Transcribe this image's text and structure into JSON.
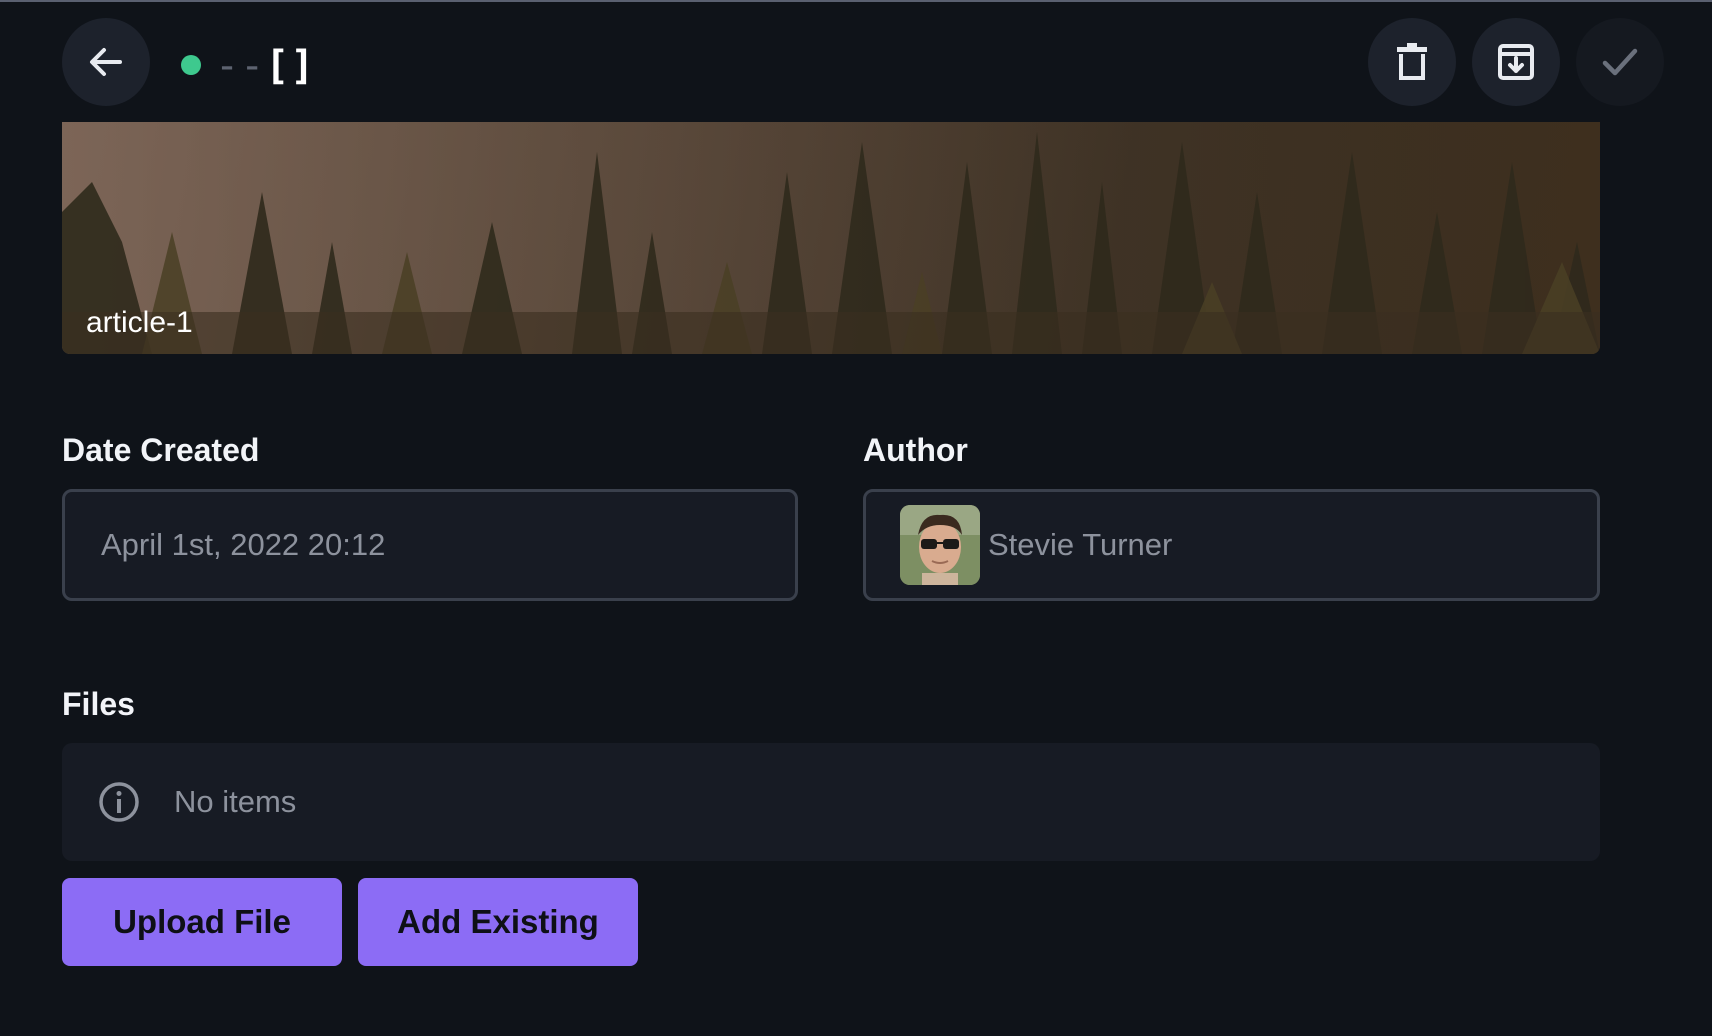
{
  "header": {
    "title_dim": "--",
    "title_main": "[]",
    "status_color": "#3ec98e",
    "back_icon": "arrow-left-icon",
    "actions": [
      {
        "icon": "trash-icon",
        "name": "delete-button"
      },
      {
        "icon": "archive-icon",
        "name": "archive-button"
      },
      {
        "icon": "check-icon",
        "name": "save-button"
      }
    ]
  },
  "banner": {
    "label": "article-1"
  },
  "fields": {
    "date_created": {
      "label": "Date Created",
      "value": "April 1st, 2022 20:12"
    },
    "author": {
      "label": "Author",
      "value": "Stevie Turner"
    }
  },
  "files": {
    "label": "Files",
    "empty_text": "No items",
    "info_icon": "info-icon",
    "upload_label": "Upload File",
    "add_existing_label": "Add Existing"
  },
  "colors": {
    "background": "#0f1319",
    "accent": "#8c6cf5",
    "panel": "#171b24"
  }
}
